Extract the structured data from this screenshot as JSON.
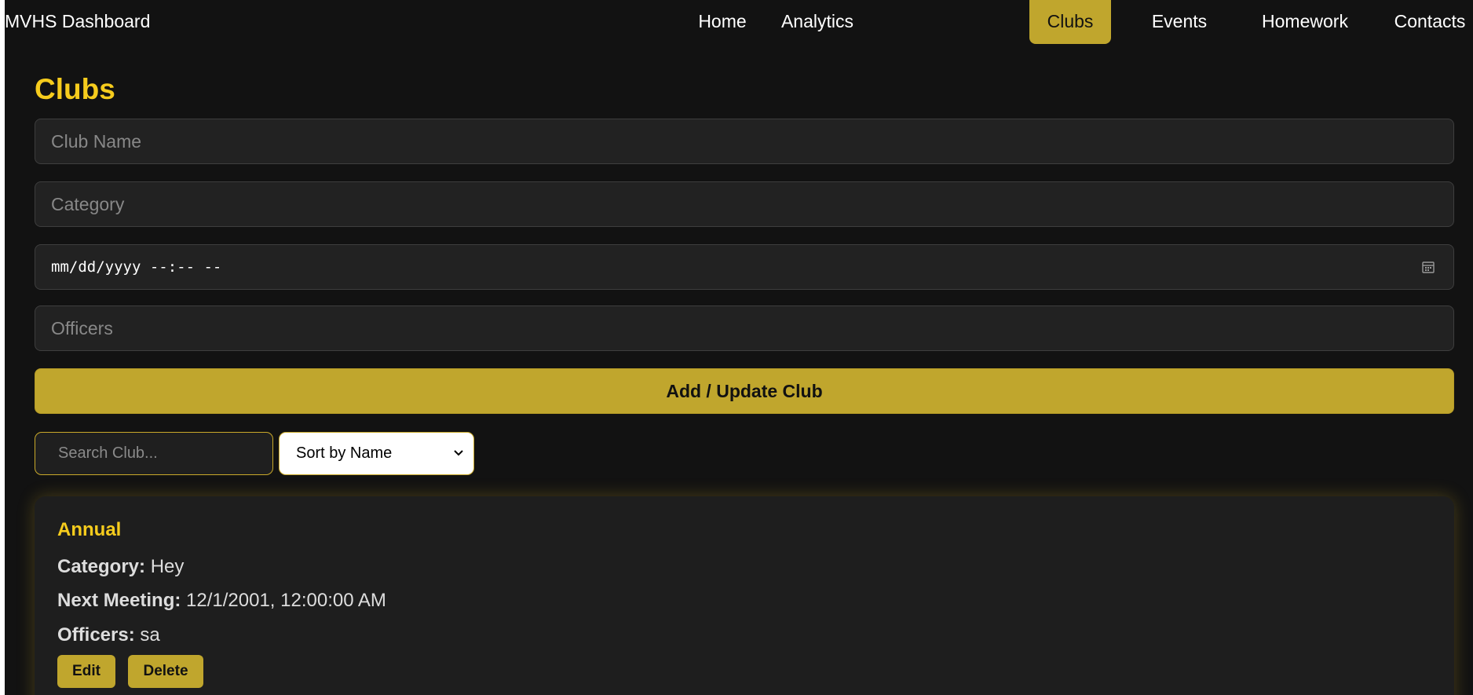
{
  "navbar": {
    "brand": "MVHS Dashboard",
    "items": [
      {
        "label": "Home"
      },
      {
        "label": "Analytics"
      },
      {
        "label": "Clubs",
        "active": true
      },
      {
        "label": "Events"
      },
      {
        "label": "Homework"
      },
      {
        "label": "Contacts"
      }
    ]
  },
  "page": {
    "title": "Clubs"
  },
  "form": {
    "club_name_placeholder": "Club Name",
    "category_placeholder": "Category",
    "datetime_placeholder": "mm/dd/yyyy --:-- --",
    "officers_placeholder": "Officers",
    "submit_label": "Add / Update Club"
  },
  "filters": {
    "search_placeholder": "Search Club...",
    "sort_selected": "Sort by Name"
  },
  "clubs": [
    {
      "name": "Annual",
      "category_label": "Category:",
      "category": "Hey",
      "meeting_label": "Next Meeting:",
      "meeting": "12/1/2001, 12:00:00 AM",
      "officers_label": "Officers:",
      "officers": "sa",
      "edit_label": "Edit",
      "delete_label": "Delete"
    }
  ],
  "colors": {
    "background": "#121212",
    "accent": "#c0a62d",
    "title_yellow": "#f6cc1d",
    "field_bg": "#222222"
  },
  "icons": {
    "date_picker": "calendar-icon",
    "sort_select": "chevron-down-icon"
  }
}
